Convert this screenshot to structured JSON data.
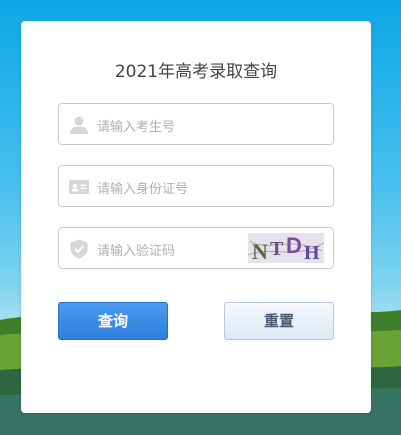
{
  "page": {
    "title": "2021年高考录取查询"
  },
  "form": {
    "candidate_no": {
      "placeholder": "请输入考生号",
      "icon": "user-icon"
    },
    "id_no": {
      "placeholder": "请输入身份证号",
      "icon": "id-card-icon"
    },
    "captcha": {
      "placeholder": "请输入验证码",
      "icon": "shield-icon",
      "image_text": "NTDH"
    }
  },
  "buttons": {
    "query_label": "查询",
    "reset_label": "重置"
  },
  "colors": {
    "primary_button": "#2f7fde",
    "reset_button": "#dde8f5",
    "background_sky": "#27b3ea"
  }
}
